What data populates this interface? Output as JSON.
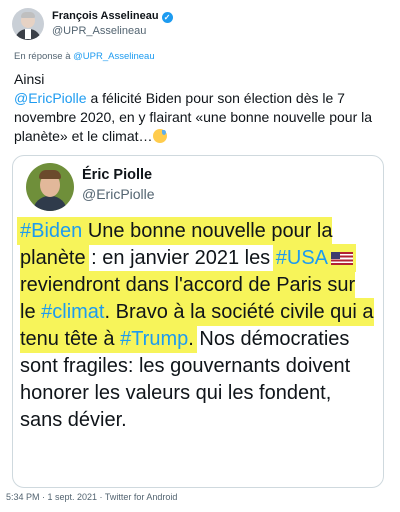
{
  "author": {
    "name": "François Asselineau",
    "handle": "@UPR_Asselineau"
  },
  "reply": {
    "prefix": "En réponse à ",
    "to": "@UPR_Asselineau"
  },
  "tweet": {
    "line1": "Ainsi",
    "mention": "@EricPiolle",
    "text": " a félicité Biden pour son élection dès le 7 novembre 2020, en y flairant «une bonne nouvelle pour la planète» et le climat…"
  },
  "quoted": {
    "name": "Éric Piolle",
    "handle": "@EricPiolle",
    "tag_biden": "#Biden",
    "seg1": " Une bonne nouvelle pour la planète",
    "seg2": " : en janvier 2021 les ",
    "tag_usa": "#USA",
    "seg3": " reviendront dans l'accord de Paris sur le ",
    "tag_climat": "#climat",
    "seg4": ". Bravo à la société civile qui a tenu tête à ",
    "tag_trump": "#Trump",
    "seg5": ".",
    "seg6": " Nos démocraties sont fragiles: les gouvernants doivent honorer les valeurs qui les fondent, sans dévier."
  },
  "footer": {
    "text": "5:34 PM · 1 sept. 2021 · Twitter for Android"
  },
  "icons": {
    "verified": "verified-badge-icon",
    "more": "more-options-icon",
    "emoji": "sweat-smile-emoji-icon",
    "flag": "us-flag-emoji-icon"
  },
  "colors": {
    "accent": "#1d9bf0",
    "highlight": "#f7f45a",
    "secondary_text": "#536471",
    "border": "#cfd9de"
  }
}
